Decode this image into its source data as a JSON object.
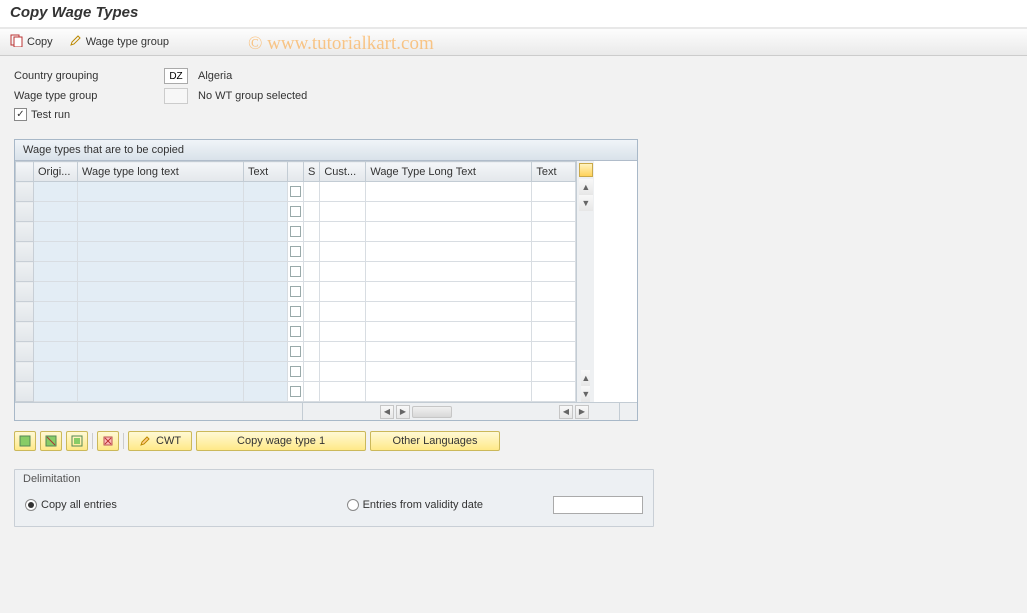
{
  "title": "Copy Wage Types",
  "watermark": "© www.tutorialkart.com",
  "toolbar": {
    "copy_label": "Copy",
    "wage_type_group_label": "Wage type group"
  },
  "form": {
    "country_grouping_label": "Country grouping",
    "country_code": "DZ",
    "country_name": "Algeria",
    "wage_type_group_label": "Wage type group",
    "wage_type_group_text": "No WT group selected",
    "test_run_label": "Test run",
    "test_run_checked": true
  },
  "table": {
    "title": "Wage types that are to be copied",
    "columns": [
      "Origi...",
      "Wage type long text",
      "Text",
      "S",
      "Cust...",
      "Wage Type Long Text",
      "Text"
    ],
    "row_count": 11
  },
  "actions": {
    "cwt_label": "CWT",
    "copy_wt1_label": "Copy wage type 1",
    "other_lang_label": "Other Languages"
  },
  "delimitation": {
    "title": "Delimitation",
    "copy_all_label": "Copy all entries",
    "entries_from_label": "Entries from validity date",
    "selected": "copy_all",
    "date_value": ""
  }
}
